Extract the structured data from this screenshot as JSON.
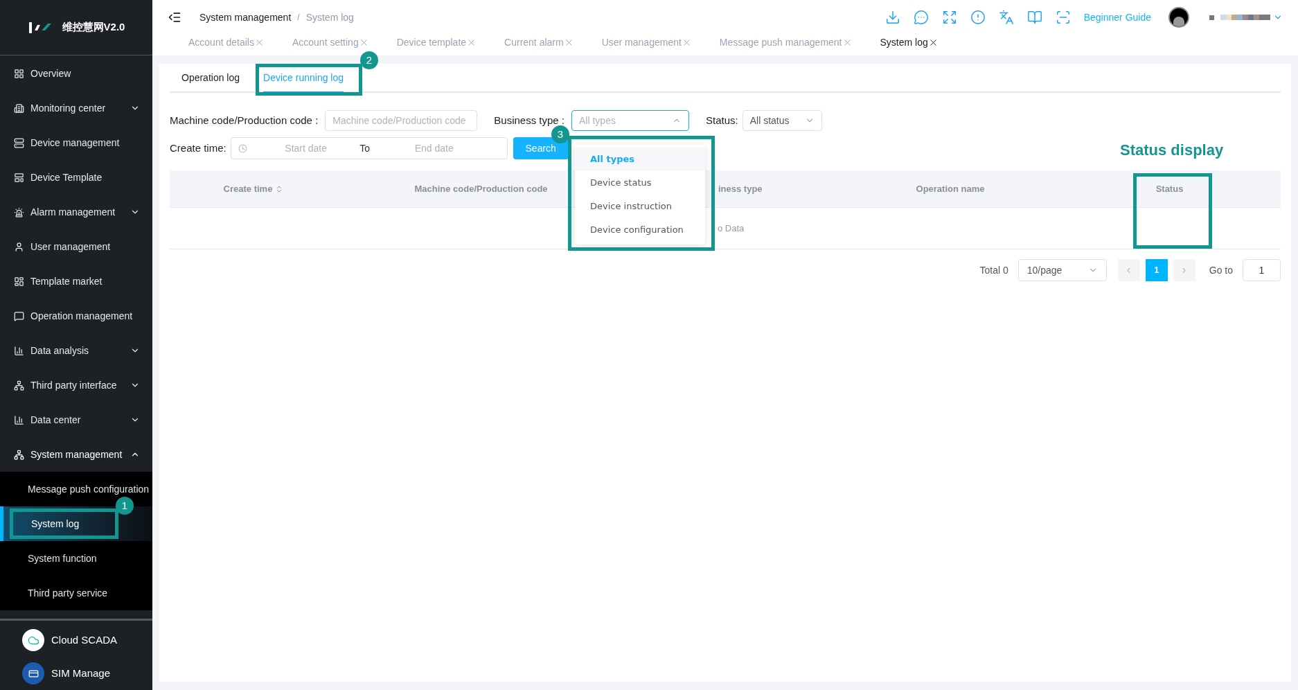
{
  "logo": {
    "text": "维控慧网V2.0"
  },
  "sidebar": {
    "items": [
      {
        "label": "Overview"
      },
      {
        "label": "Monitoring center",
        "expanded": false
      },
      {
        "label": "Device management"
      },
      {
        "label": "Device Template"
      },
      {
        "label": "Alarm management",
        "expanded": false
      },
      {
        "label": "User management"
      },
      {
        "label": "Template market"
      },
      {
        "label": "Operation management"
      },
      {
        "label": "Data analysis",
        "expanded": false
      },
      {
        "label": "Third party interface",
        "expanded": false
      },
      {
        "label": "Data center",
        "expanded": false
      },
      {
        "label": "System management",
        "expanded": true,
        "children": [
          {
            "label": "Message push configuration",
            "selected": false
          },
          {
            "label": "System log",
            "selected": true
          },
          {
            "label": "System function",
            "selected": false
          },
          {
            "label": "Third party service",
            "selected": false
          }
        ]
      }
    ],
    "apps": [
      {
        "label": "Cloud SCADA"
      },
      {
        "label": "SIM Manage"
      }
    ]
  },
  "breadcrumb": [
    "System management",
    "System log"
  ],
  "breadcrumb_separator": "/",
  "header": {
    "guide": "Beginner Guide"
  },
  "open_tabs": [
    {
      "label": "Account details",
      "selected": false
    },
    {
      "label": "Account setting",
      "selected": false
    },
    {
      "label": "Device template",
      "selected": false
    },
    {
      "label": "Current alarm",
      "selected": false
    },
    {
      "label": "User management",
      "selected": false
    },
    {
      "label": "Message push management",
      "selected": false
    },
    {
      "label": "System log",
      "selected": true
    }
  ],
  "content_tabs": [
    {
      "label": "Operation log",
      "selected": false
    },
    {
      "label": "Device running log",
      "selected": true
    }
  ],
  "filters": {
    "machine_code": {
      "label": "Machine code/Production code :",
      "placeholder": "Machine code/Production code"
    },
    "business_type": {
      "label": "Business type :",
      "value": "All types",
      "open": true,
      "options": [
        {
          "label": "All types",
          "selected": true
        },
        {
          "label": "Device status",
          "selected": false
        },
        {
          "label": "Device instruction",
          "selected": false
        },
        {
          "label": "Device configuration",
          "selected": false
        }
      ]
    },
    "status": {
      "label": "Status:",
      "value": "All status"
    },
    "create_time": {
      "label": "Create time:",
      "start_placeholder": "Start date",
      "separator": "To",
      "end_placeholder": "End date"
    },
    "search_button": "Search"
  },
  "table": {
    "columns": [
      {
        "label": "Create time",
        "sortable": true
      },
      {
        "label": "Machine code/Production code"
      },
      {
        "label": "iness type"
      },
      {
        "label": "Operation name"
      },
      {
        "label": "Status"
      }
    ],
    "empty_text": "o Data"
  },
  "pagination": {
    "total": "Total 0",
    "page_size": "10/page",
    "pages": [
      {
        "label": "1",
        "selected": true
      }
    ],
    "goto_label": "Go to",
    "goto_value": "1"
  },
  "annotations": {
    "badges": [
      "1",
      "2",
      "3"
    ],
    "status_caption": "Status display"
  }
}
